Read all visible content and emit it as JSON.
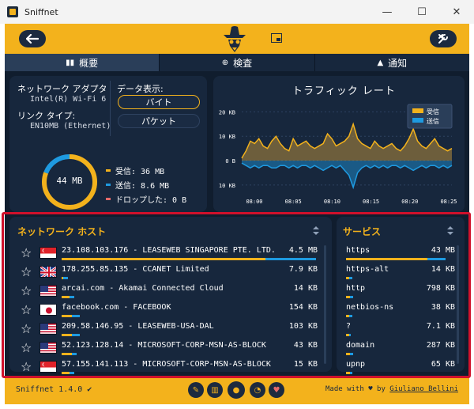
{
  "window": {
    "title": "Sniffnet",
    "minimize": "—",
    "maximize": "☐",
    "close": "✕"
  },
  "tabs": [
    {
      "label": "概要",
      "icon": "chart-icon",
      "active": true
    },
    {
      "label": "検査",
      "icon": "inspect-icon",
      "active": false
    },
    {
      "label": "通知",
      "icon": "bell-icon",
      "active": false
    }
  ],
  "info": {
    "adapter_label": "ネットワーク アダプタ",
    "adapter_value": "Intel(R) Wi-Fi 6 A",
    "link_label": "リンク タイプ:",
    "link_value": "EN10MB (Ethernet)",
    "display_label": "データ表示:",
    "display_options": [
      "バイト",
      "パケット"
    ],
    "donut_value": "44 MB",
    "received": "受信: 36 MB",
    "sent": "送信: 8.6 MB",
    "dropped": "ドロップした: 0 B"
  },
  "colors": {
    "accent": "#f3b21c",
    "received": "#f3b21c",
    "sent": "#1e9ae0",
    "dropped": "#e66a6a",
    "panel": "#17273d",
    "background": "#101d2e",
    "highlight": "#d0112b"
  },
  "chart_data": {
    "type": "area",
    "title": "トラフィック レート",
    "xlabel": "",
    "ylabel": "",
    "x": [
      "08:00",
      "08:05",
      "08:10",
      "08:15",
      "08:20",
      "08:25"
    ],
    "yticks": [
      "20 KB",
      "10 KB",
      "0 B",
      "10 KB"
    ],
    "ylim": [
      -12,
      25
    ],
    "legend": [
      "受信",
      "送信"
    ],
    "legend_position": "top-right",
    "series": [
      {
        "name": "受信",
        "values": [
          1,
          4,
          8,
          7,
          9,
          6,
          5,
          8,
          10,
          7,
          5,
          4,
          9,
          6,
          7,
          8,
          6,
          5,
          6,
          7,
          11,
          9,
          6,
          7,
          8,
          10,
          15,
          9,
          7,
          6,
          5,
          8,
          6,
          5,
          6,
          7,
          5,
          4,
          6,
          9,
          13,
          8,
          6,
          5,
          7,
          9,
          6,
          5,
          4,
          5
        ]
      },
      {
        "name": "送信",
        "values": [
          -1,
          -2,
          -3,
          -2,
          -3,
          -2,
          -2,
          -3,
          -3,
          -2,
          -2,
          -3,
          -2,
          -3,
          -2,
          -2,
          -3,
          -2,
          -3,
          -4,
          -3,
          -2,
          -3,
          -2,
          -4,
          -6,
          -11,
          -5,
          -3,
          -2,
          -3,
          -2,
          -3,
          -2,
          -3,
          -2,
          -2,
          -3,
          -2,
          -3,
          -4,
          -3,
          -2,
          -3,
          -2,
          -2,
          -3,
          -2,
          -3,
          -2
        ]
      }
    ]
  },
  "hosts": {
    "title": "ネットワーク ホスト",
    "items": [
      {
        "flag": "sg",
        "label": "23.108.103.176 - LEASEWEB SINGAPORE PTE. LTD.",
        "value": "4.5 MB",
        "in": 0.8,
        "out": 0.2
      },
      {
        "flag": "gb",
        "label": "178.255.85.135 - CCANET Limited",
        "value": "7.9 KB",
        "in": 0.0,
        "out": 0.02
      },
      {
        "flag": "us",
        "label": "arcai.com - Akamai Connected Cloud",
        "value": "14 KB",
        "in": 0.03,
        "out": 0.02
      },
      {
        "flag": "jp",
        "label": "facebook.com - FACEBOOK",
        "value": "154 KB",
        "in": 0.04,
        "out": 0.03
      },
      {
        "flag": "us",
        "label": "209.58.146.95 - LEASEWEB-USA-DAL",
        "value": "103 KB",
        "in": 0.04,
        "out": 0.03
      },
      {
        "flag": "us",
        "label": "52.123.128.14 - MICROSOFT-CORP-MSN-AS-BLOCK",
        "value": "43 KB",
        "in": 0.04,
        "out": 0.02
      },
      {
        "flag": "sg",
        "label": "57.155.141.113 - MICROSOFT-CORP-MSN-AS-BLOCK",
        "value": "15 KB",
        "in": 0.03,
        "out": 0.02
      }
    ]
  },
  "services": {
    "title": "サービス",
    "items": [
      {
        "label": "https",
        "value": "43 MB",
        "in": 0.82,
        "out": 0.18
      },
      {
        "label": "https-alt",
        "value": "14 KB",
        "in": 0.03,
        "out": 0.03
      },
      {
        "label": "http",
        "value": "798 KB",
        "in": 0.04,
        "out": 0.03
      },
      {
        "label": "netbios-ns",
        "value": "38 KB",
        "in": 0.03,
        "out": 0.03
      },
      {
        "label": "?",
        "value": "7.1 KB",
        "in": 0.03,
        "out": 0.02
      },
      {
        "label": "domain",
        "value": "287 KB",
        "in": 0.04,
        "out": 0.03
      },
      {
        "label": "upnp",
        "value": "65 KB",
        "in": 0.04,
        "out": 0.02
      }
    ]
  },
  "footer": {
    "version": "Sniffnet 1.4.0 ✔",
    "made_with": "Made with",
    "by": "by",
    "author": "Giuliano Bellini"
  }
}
